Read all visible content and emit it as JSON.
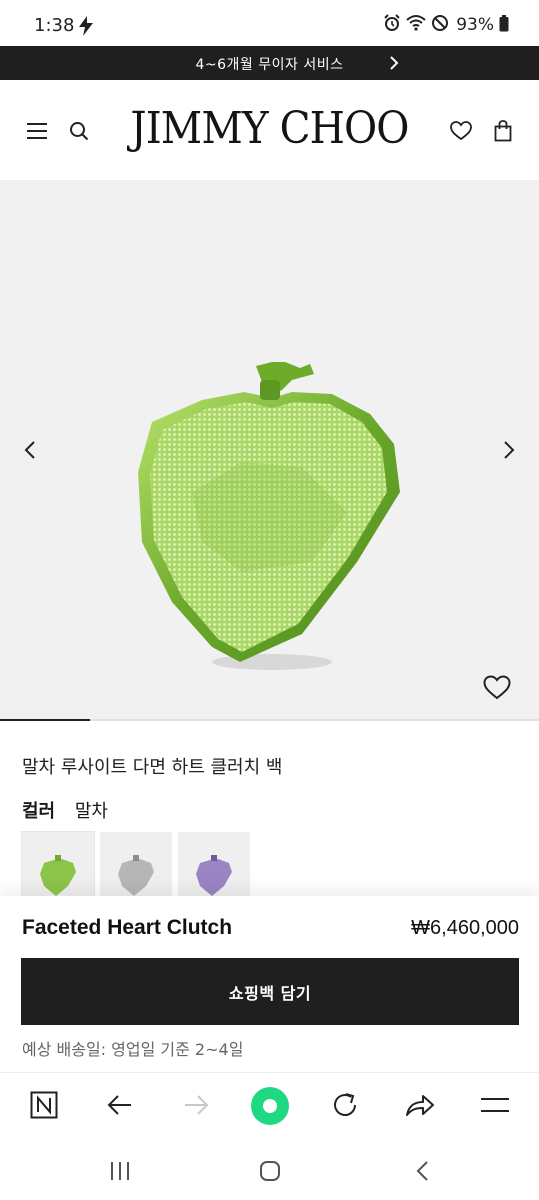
{
  "status_bar": {
    "time": "1:38",
    "battery": "93%",
    "icons": [
      "bolt-icon",
      "alarm-icon",
      "wifi-icon",
      "do-not-disturb-icon",
      "battery-icon"
    ]
  },
  "promo": {
    "text": "4~6개월 무이자 서비스",
    "icon": "chevron-right-icon"
  },
  "header": {
    "brand": "JIMMY CHOO",
    "icons": [
      "menu-icon",
      "search-icon",
      "heart-icon",
      "bag-icon"
    ]
  },
  "gallery": {
    "image": "green faceted heart clutch",
    "progress": 0.167,
    "icons": [
      "chevron-left-icon",
      "chevron-right-icon",
      "heart-icon"
    ]
  },
  "product": {
    "name": "말차 루사이트 다면 하트 클러치 백",
    "color_label": "컬러",
    "color_value": "말차",
    "swatches": [
      {
        "color": "#8cc44a",
        "name": "green"
      },
      {
        "color": "#b6b6b6",
        "name": "silver"
      },
      {
        "color": "#9a84c4",
        "name": "purple"
      }
    ]
  },
  "sticky": {
    "title": "Faceted Heart Clutch",
    "price": "₩6,460,000",
    "cart_button": "쇼핑백 담기",
    "delivery": "예상 배송일: 영업일 기준 2~4일"
  },
  "browser_bar": {
    "icons": [
      "naver-n-icon",
      "back-arrow-icon",
      "forward-arrow-icon",
      "green-dot-icon",
      "refresh-icon",
      "share-icon",
      "hamburger-icon"
    ]
  },
  "nav_bar": {
    "icons": [
      "recent-apps-icon",
      "home-icon",
      "back-icon"
    ]
  },
  "colors": {
    "promo_bg": "#1f1f1f",
    "gallery_bg": "#f1f1f1",
    "accent_green": "#1ed982"
  }
}
